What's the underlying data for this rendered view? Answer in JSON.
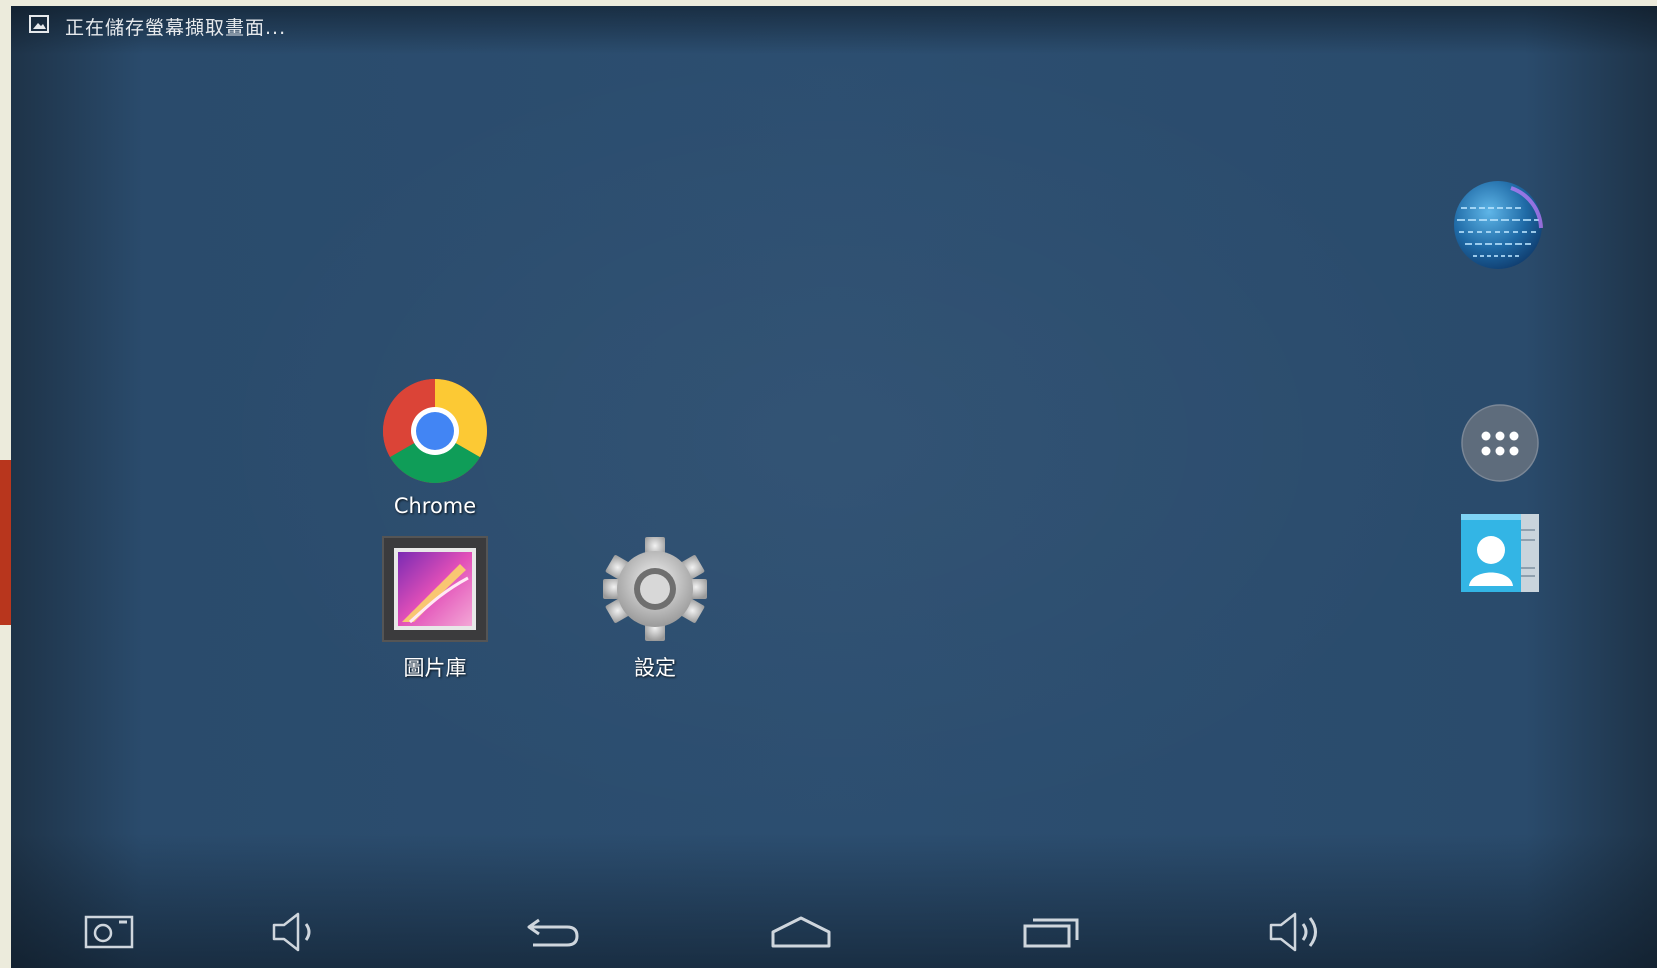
{
  "status_bar": {
    "notification_icon": "image-icon",
    "notification_text": "正在儲存螢幕擷取畫面..."
  },
  "desktop": {
    "apps": [
      {
        "label": "Chrome",
        "icon": "chrome-icon"
      },
      {
        "label": "圖片庫",
        "icon": "gallery-icon"
      },
      {
        "label": "設定",
        "icon": "gear-icon"
      }
    ]
  },
  "dock": {
    "items": [
      {
        "icon": "browser-globe-icon"
      },
      {
        "icon": "app-drawer-icon"
      },
      {
        "icon": "contacts-icon"
      }
    ]
  },
  "nav_bar": {
    "buttons": [
      {
        "icon": "screenshot-camera-icon"
      },
      {
        "icon": "volume-down-icon"
      },
      {
        "icon": "back-icon"
      },
      {
        "icon": "home-icon"
      },
      {
        "icon": "recent-apps-icon"
      },
      {
        "icon": "volume-up-icon"
      }
    ]
  },
  "colors": {
    "wallpaper": "#2c4e70",
    "outer_frame": "#ecebdc",
    "side_tab": "#b8361d"
  }
}
